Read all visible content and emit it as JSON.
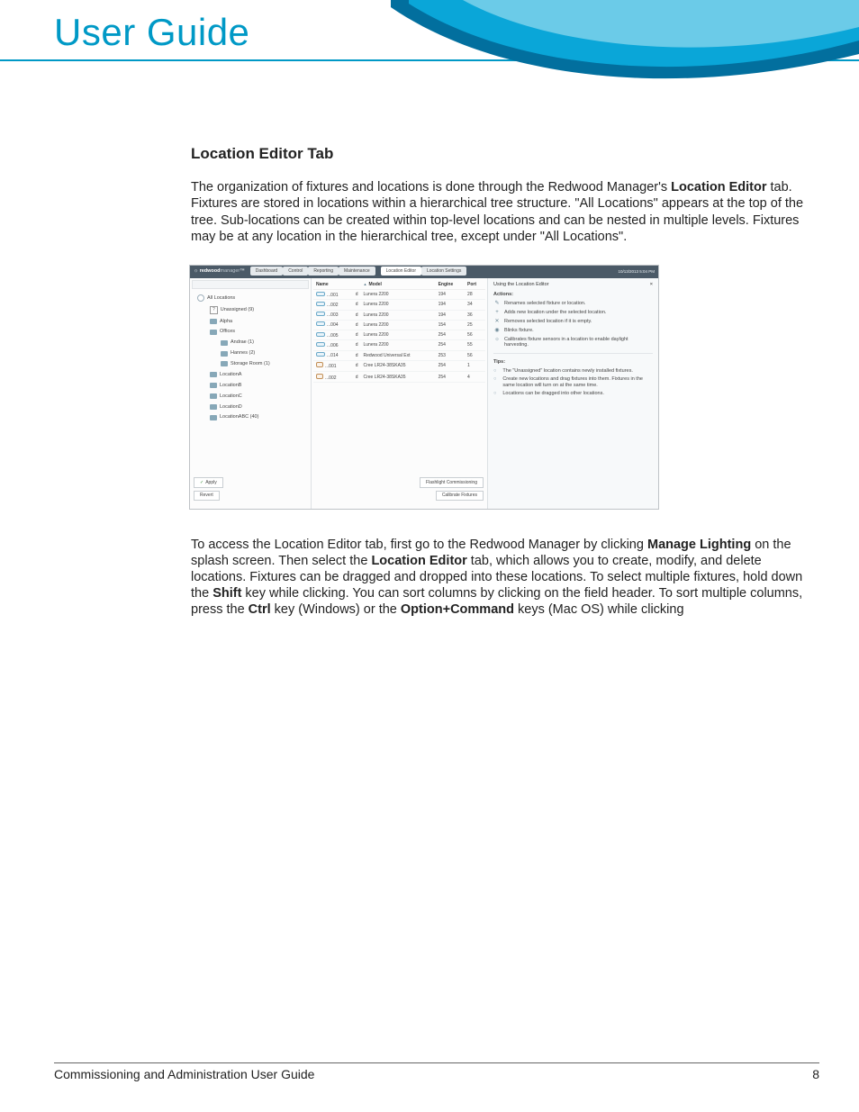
{
  "header": {
    "title": "User Guide"
  },
  "footer": {
    "text": "Commissioning and Administration User Guide",
    "page": "8"
  },
  "section": {
    "heading": "Location Editor Tab",
    "p1_a": "The organization of fixtures and locations is done through the Redwood Manager's ",
    "p1_b": "Location Editor",
    "p1_c": " tab. Fixtures are stored in locations within a hierarchical tree structure. \"All Locations\" appears at the top of the tree. Sub-locations can be created within top-level locations and can be nested in multiple levels. Fixtures may be at any location in the hierarchical tree, except under \"All Locations\".",
    "p2_a": "To access the Location Editor tab, first go to the Redwood Manager by clicking ",
    "p2_b": "Manage Lighting",
    "p2_c": " on the splash screen. Then select the ",
    "p2_d": "Location Editor",
    "p2_e": " tab, which allows you to create, modify, and delete locations. Fixtures can be dragged and dropped into these locations. To select multiple fixtures, hold down the ",
    "p2_f": "Shift",
    "p2_g": " key while clicking. You can sort columns by clicking on the field header. To sort multiple columns, press the ",
    "p2_h": "Ctrl",
    "p2_i": " key (Windows) or the ",
    "p2_j": "Option+Command",
    "p2_k": " keys (Mac OS) while clicking"
  },
  "mini": {
    "brand_bold": "redwood",
    "brand_light": "manager",
    "tabs1": [
      "Dashboard",
      "Control",
      "Reporting",
      "Maintenance"
    ],
    "tabs2": [
      "Location Editor",
      "Location Settings"
    ],
    "datetime": "10/13/2013\n5:04 PM",
    "tree": [
      {
        "lvl": "l1",
        "icon": "ic-globe",
        "label": "All Locations"
      },
      {
        "lvl": "l2",
        "icon": "q",
        "label": "Unassigned (9)"
      },
      {
        "lvl": "l2",
        "icon": "ic",
        "label": "Alpha"
      },
      {
        "lvl": "l2",
        "icon": "ic",
        "label": "Offices"
      },
      {
        "lvl": "l3",
        "icon": "ic",
        "label": "Andrae (1)"
      },
      {
        "lvl": "l3",
        "icon": "ic",
        "label": "Hannes (2)"
      },
      {
        "lvl": "l3",
        "icon": "ic",
        "label": "Storage Room (1)"
      },
      {
        "lvl": "l2",
        "icon": "ic",
        "label": "LocationA"
      },
      {
        "lvl": "l2",
        "icon": "ic",
        "label": "LocationB"
      },
      {
        "lvl": "l2",
        "icon": "ic",
        "label": "LocationC"
      },
      {
        "lvl": "l2",
        "icon": "ic",
        "label": "LocationD"
      },
      {
        "lvl": "l2",
        "icon": "ic",
        "label": "LocationABC (40)"
      }
    ],
    "apply": "Apply",
    "revert": "Revert",
    "table": {
      "cols": [
        "Name",
        "",
        "Model",
        "Engine",
        "Port"
      ],
      "rows": [
        {
          "ic": "fx",
          "name": "...001",
          "info": "d",
          "model": "Lunera 2200",
          "eng": "194",
          "port": "28"
        },
        {
          "ic": "fx",
          "name": "...002",
          "info": "d",
          "model": "Lunera 2200",
          "eng": "194",
          "port": "34"
        },
        {
          "ic": "fx",
          "name": "...003",
          "info": "d",
          "model": "Lunera 2200",
          "eng": "194",
          "port": "36"
        },
        {
          "ic": "fx",
          "name": "...004",
          "info": "d",
          "model": "Lunera 2200",
          "eng": "154",
          "port": "25"
        },
        {
          "ic": "fx",
          "name": "...005",
          "info": "d",
          "model": "Lunera 2200",
          "eng": "254",
          "port": "56"
        },
        {
          "ic": "fx",
          "name": "...006",
          "info": "d",
          "model": "Lunera 2200",
          "eng": "254",
          "port": "55"
        },
        {
          "ic": "fx",
          "name": "...014",
          "info": "d",
          "model": "Redwood Universal Ext",
          "eng": "253",
          "port": "56"
        },
        {
          "ic": "alt",
          "name": "...001",
          "info": "d",
          "model": "Cree LR24-38SKA35",
          "eng": "254",
          "port": "1"
        },
        {
          "ic": "alt",
          "name": "...002",
          "info": "d",
          "model": "Cree LR24-38SKA35",
          "eng": "254",
          "port": "4"
        }
      ],
      "btn1": "Flashlight Commissioning",
      "btn2": "Calibrate Fixtures"
    },
    "panel": {
      "title": "Using the Location Editor",
      "actions_label": "Actions:",
      "actions": [
        {
          "ic": "✎",
          "t": "Renames selected fixture or location."
        },
        {
          "ic": "+",
          "t": "Adds new location under the selected location."
        },
        {
          "ic": "✕",
          "t": "Removes selected location if it is empty."
        },
        {
          "ic": "◉",
          "t": "Blinks fixture."
        },
        {
          "ic": "☼",
          "t": "Calibrates fixture sensors in a location to enable daylight harvesting."
        }
      ],
      "tips_label": "Tips:",
      "tips": [
        "The \"Unassigned\" location contains newly installed fixtures.",
        "Create new locations and drag fixtures into them. Fixtures in the same location will turn on at the same time.",
        "Locations can be dragged into other locations."
      ]
    }
  }
}
